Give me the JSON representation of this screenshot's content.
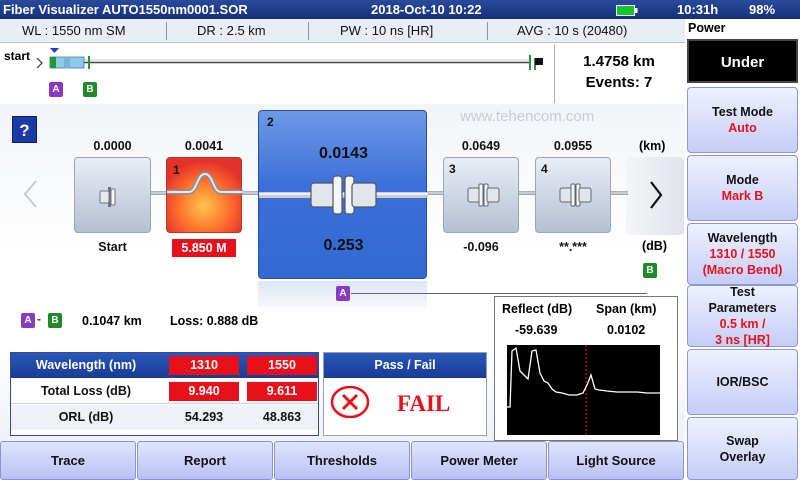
{
  "status": {
    "title": "Fiber Visualizer AUTO1550nm0001.SOR",
    "datetime": "2018-Oct-10 10:22",
    "battery_time": "10:31h",
    "battery_pct": "98%"
  },
  "info": {
    "wl": "WL : 1550 nm SM",
    "dr": "DR : 2.5 km",
    "pw": "PW : 10 ns [HR]",
    "avg": "AVG : 10 s (20480)"
  },
  "overview": {
    "start": "start",
    "marker_a": "A",
    "marker_b": "B",
    "distance": "1.4758 km",
    "events": "Events: 7"
  },
  "watermark": "www.tehencom.com",
  "help": "?",
  "units": {
    "km": "(km)",
    "db": "(dB)"
  },
  "events": [
    {
      "num": "",
      "position": "0.0000",
      "label": "Start"
    },
    {
      "num": "1",
      "position": "0.0041",
      "label": "5.850 M"
    },
    {
      "num": "2",
      "position": "0.0143",
      "label": "0.253"
    },
    {
      "num": "3",
      "position": "0.0649",
      "label": "-0.096"
    },
    {
      "num": "4",
      "position": "0.0955",
      "label": "**.***"
    }
  ],
  "ab": {
    "distance": "0.1047 km",
    "loss": "Loss: 0.888 dB"
  },
  "zoom": {
    "reflect_label": "Reflect (dB)",
    "span_label": "Span (km)",
    "reflect": "-59.639",
    "span": "0.0102"
  },
  "table": {
    "wavelength_label": "Wavelength (nm)",
    "wl1": "1310",
    "wl2": "1550",
    "totalloss_label": "Total Loss (dB)",
    "tl1": "9.940",
    "tl2": "9.611",
    "orl_label": "ORL (dB)",
    "orl1": "54.293",
    "orl2": "48.863"
  },
  "passfail": {
    "label": "Pass / Fail",
    "result": "FAIL"
  },
  "side": {
    "power": "Power",
    "under": "Under",
    "testmode": "Test Mode",
    "testmode_val": "Auto",
    "mode": "Mode",
    "mode_val": "Mark B",
    "wavelength": "Wavelength",
    "wavelength_val1": "1310 / 1550",
    "wavelength_val2": "(Macro Bend)",
    "testparams1": "Test",
    "testparams2": "Parameters",
    "testparams_val1": "0.5 km /",
    "testparams_val2": "3 ns [HR]",
    "ior": "IOR/BSC",
    "swap1": "Swap",
    "swap2": "Overlay"
  },
  "tabs": [
    "Trace",
    "Report",
    "Thresholds",
    "Power Meter",
    "Light Source"
  ],
  "colors": {
    "fail_red": "#e8101a",
    "header_blue": "#1c3a8e",
    "marker_a": "#8a3ac0",
    "marker_b": "#1f8a2a",
    "selected_event": "#3d6fd6"
  }
}
